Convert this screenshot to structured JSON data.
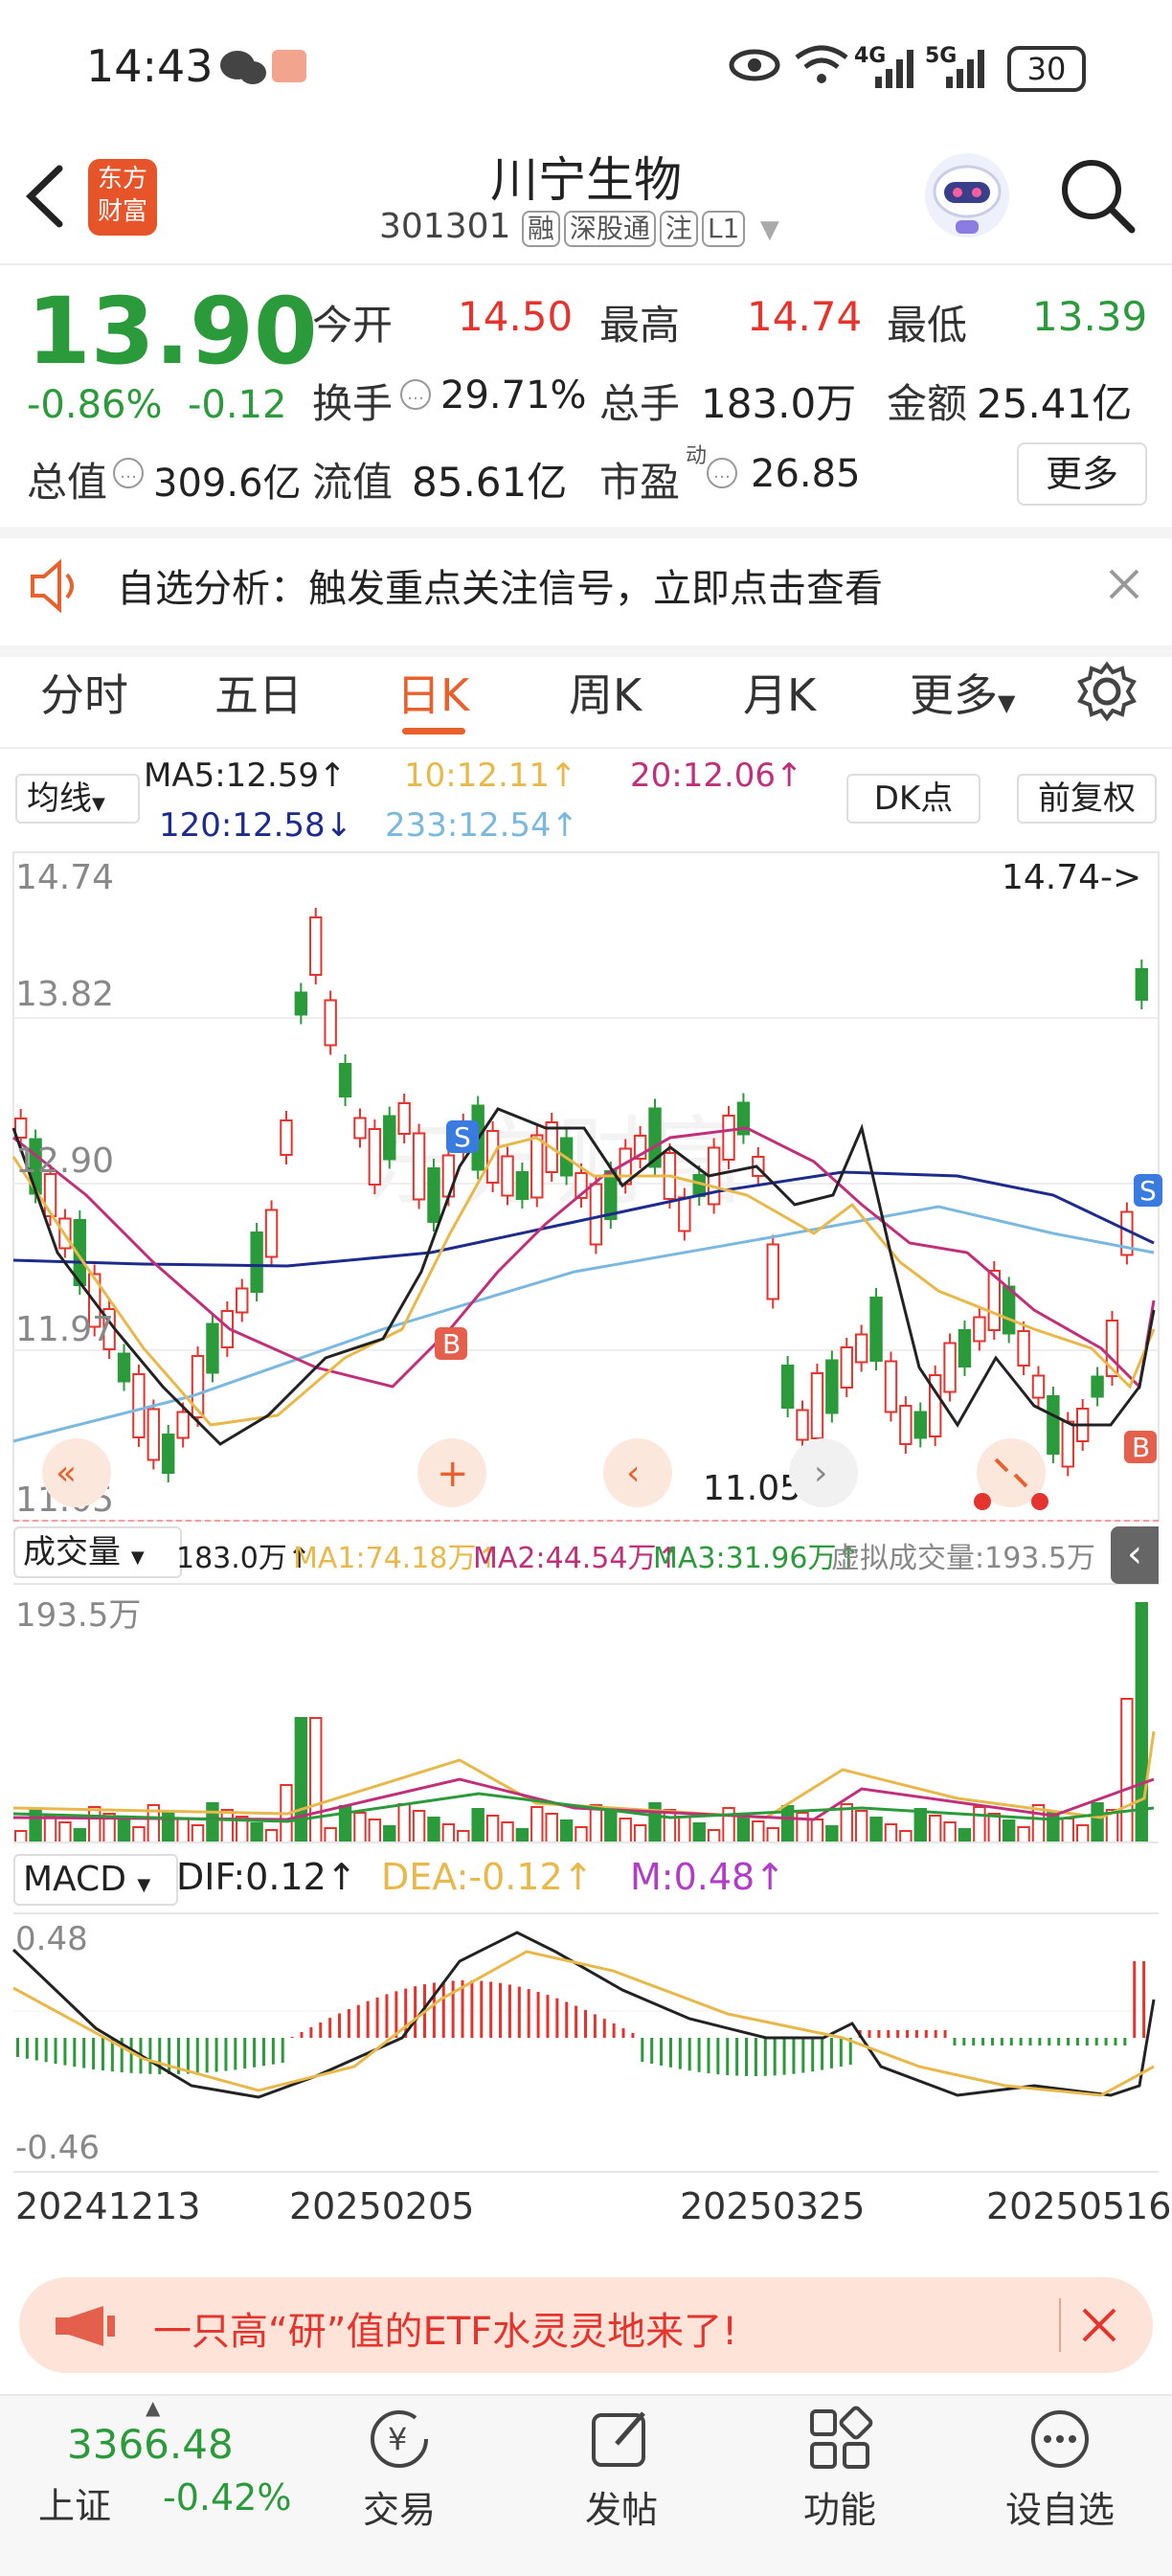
{
  "status": {
    "time": "14:43",
    "battery": "30",
    "net1": "4G",
    "net2": "5G"
  },
  "header": {
    "name": "川宁生物",
    "code": "301301",
    "tags": [
      "融",
      "深股通",
      "注",
      "L1"
    ],
    "logo_line1": "东方",
    "logo_line2": "财富"
  },
  "quote": {
    "price": "13.90",
    "change_pct": "-0.86%",
    "change": "-0.12",
    "open_label": "今开",
    "open": "14.50",
    "high_label": "最高",
    "high": "14.74",
    "low_label": "最低",
    "low": "13.39",
    "turnover_label": "换手",
    "turnover": "29.71%",
    "volume_label": "总手",
    "volume": "183.0万",
    "amount_label": "金额",
    "amount": "25.41亿",
    "mcap_label": "总值",
    "mcap": "309.6亿",
    "float_label": "流值",
    "float": "85.61亿",
    "pe_label": "市盈",
    "pe_sup": "动",
    "pe": "26.85",
    "more": "更多"
  },
  "notice": {
    "text": "自选分析：触发重点关注信号，立即点击查看"
  },
  "tabs": [
    "分时",
    "五日",
    "日K",
    "周K",
    "月K",
    "更多"
  ],
  "ma": {
    "selector": "均线",
    "ma5": "MA5:12.59↑",
    "ma10": "10:12.11↑",
    "ma20": "20:12.06↑",
    "ma120": "120:12.58↓",
    "ma233": "233:12.54↑",
    "dk": "DK点",
    "fuquan": "前复权"
  },
  "kchart": {
    "y_labels": [
      "14.74",
      "13.82",
      "12.90",
      "11.97",
      "11.05"
    ],
    "max_marker": "14.74->",
    "min_marker": "11.05->",
    "signal_s": "S",
    "signal_b": "B"
  },
  "volume_panel": {
    "selector": "成交量",
    "vol": "183.0万↑",
    "ma1": "MA1:74.18万↑",
    "ma2": "MA2:44.54万↑",
    "ma3": "MA3:31.96万↑",
    "virtual": "虚拟成交量:193.5万",
    "ymax": "193.5万"
  },
  "macd_panel": {
    "selector": "MACD",
    "dif": "DIF:0.12↑",
    "dea": "DEA:-0.12↑",
    "m": "M:0.48↑",
    "ymax": "0.48",
    "ymin": "-0.46"
  },
  "dates": [
    "20241213",
    "20250205",
    "20250325",
    "20250516"
  ],
  "banner": {
    "text": "一只高“研”值的ETF水灵灵地来了!"
  },
  "bottom": {
    "index_value": "3366.48",
    "index_name": "上证",
    "index_change": "-0.42%",
    "items": [
      "交易",
      "发帖",
      "功能",
      "设自选"
    ]
  },
  "colors": {
    "red": "#e5332d",
    "green": "#2b9a3b",
    "ma5": "#222222",
    "ma10": "#e8b84a",
    "ma20": "#c0307a",
    "ma120": "#1c2b8c",
    "ma233": "#7ab8e0"
  }
}
